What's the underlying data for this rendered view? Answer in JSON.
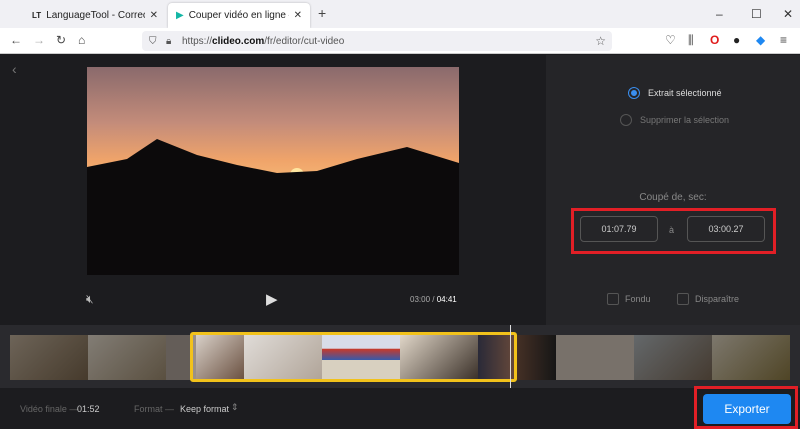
{
  "browser": {
    "tabs": [
      {
        "label": "LanguageTool - Correcteur d'or",
        "icon": "languagetool-icon"
      },
      {
        "label": "Couper vidéo en ligne — Rogn",
        "icon": "clideo-icon"
      }
    ],
    "url_prefix": "https://",
    "url_domain": "clideo.com",
    "url_path": "/fr/editor/cut-video"
  },
  "player": {
    "current_time": "03:00",
    "separator": "/",
    "total_time": "04:41"
  },
  "options": {
    "keep_selected": "Extrait sélectionné",
    "delete_selected": "Supprimer la sélection"
  },
  "cut": {
    "label": "Coupé de, sec:",
    "from": "01:07.79",
    "to_word": "à",
    "to": "03:00.27"
  },
  "effects": {
    "fade_in": "Fondu",
    "fade_out": "Disparaître"
  },
  "bottom": {
    "final_label": "Vidéo finale —",
    "final_value": "01:52",
    "format_label": "Format —",
    "format_value": "Keep format",
    "export": "Exporter"
  },
  "colors": {
    "accent": "#1e88f2",
    "highlight": "#e21f26",
    "selection": "#f2c21b"
  }
}
